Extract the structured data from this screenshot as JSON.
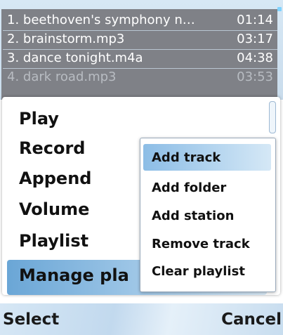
{
  "playlist": {
    "tracks": [
      {
        "title": "1. beethoven's symphony n…",
        "duration": "01:14"
      },
      {
        "title": "2. brainstorm.mp3",
        "duration": "03:17"
      },
      {
        "title": "3. dance tonight.m4a",
        "duration": "04:38"
      },
      {
        "title": "4. dark road.mp3",
        "duration": "03:53"
      }
    ]
  },
  "menu": {
    "items": [
      "Play",
      "Record",
      "Append",
      "Volume",
      "Playlist",
      "Manage pla"
    ],
    "highlighted_index": 5
  },
  "submenu": {
    "items": [
      "Add track",
      "Add folder",
      "Add station",
      "Remove track",
      "Clear playlist"
    ],
    "highlighted_index": 0
  },
  "softkeys": {
    "left": "Select",
    "right": "Cancel"
  },
  "colors": {
    "highlight": "#6aa6d6",
    "playlist_bg": "#7f8187",
    "scroll_marker": "#7fd3ff"
  }
}
